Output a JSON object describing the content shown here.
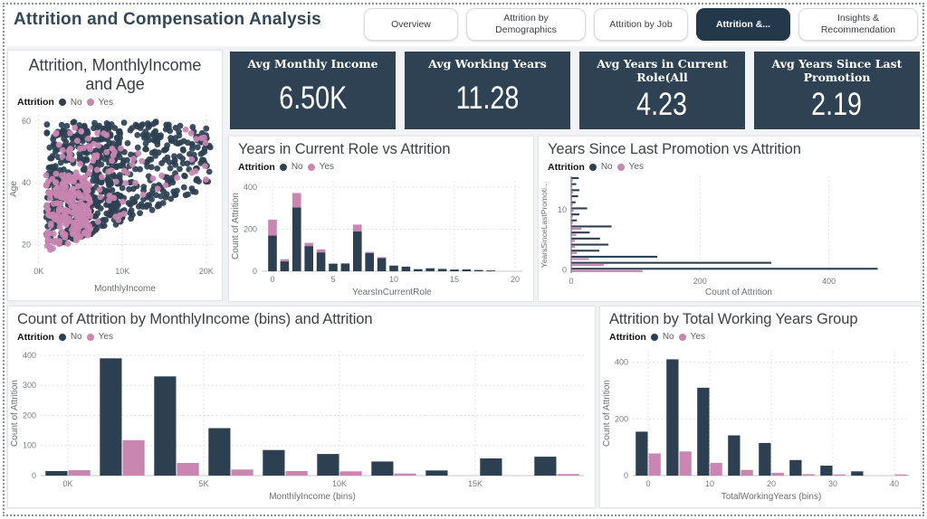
{
  "header": {
    "title": "Attrition and Compensation Analysis",
    "tabs": [
      {
        "label": "Overview",
        "active": false
      },
      {
        "label": "Attrition by Demographics",
        "active": false
      },
      {
        "label": "Attrition by Job",
        "active": false
      },
      {
        "label": "Attrition &...",
        "active": true
      },
      {
        "label": "Insights & Recommendation",
        "active": false
      }
    ]
  },
  "kpis": [
    {
      "title": "Avg Monthly Income",
      "value": "6.50K"
    },
    {
      "title": "Avg Working Years",
      "value": "11.28"
    },
    {
      "title": "Avg Years in Current Role(All",
      "value": "4.23"
    },
    {
      "title": "Avg Years Since Last Promotion",
      "value": "2.19"
    }
  ],
  "legend": {
    "title": "Attrition",
    "no": "No",
    "yes": "Yes"
  },
  "colors": {
    "no": "#2d4052",
    "yes": "#c886b1",
    "kpi_bg": "#2e4254",
    "active_tab_bg": "#24384b",
    "title_text": "#33475a",
    "grid": "#d8dadd",
    "tick_text": "#777b7f",
    "axis_line": "#9ea2a6"
  },
  "chart_data": [
    {
      "type": "scatter",
      "title": "Attrition, MonthlyIncome and Age",
      "xlabel": "MonthlyIncome",
      "ylabel": "Age",
      "xlim": [
        -400,
        21000
      ],
      "ylim": [
        14,
        62
      ],
      "xticks": [
        {
          "v": 0,
          "label": "0K"
        },
        {
          "v": 10000,
          "label": "10K"
        },
        {
          "v": 20000,
          "label": "20K"
        }
      ],
      "yticks": [
        {
          "v": 20,
          "label": "20"
        },
        {
          "v": 40,
          "label": "40"
        },
        {
          "v": 60,
          "label": "60"
        }
      ],
      "series": [
        {
          "name": "No"
        },
        {
          "name": "Yes"
        }
      ],
      "points_spec": {
        "min_age_base": 16.5,
        "min_age_slope_per_k": 1.08,
        "radius": 3.4,
        "no_clusters": [
          {
            "seed": 101,
            "n": 420,
            "x": [
              900,
              20500
            ],
            "y": [
              18,
              60
            ]
          },
          {
            "seed": 102,
            "n": 300,
            "x": [
              900,
              10000
            ],
            "y": [
              20,
              58
            ]
          }
        ],
        "yes_clusters": [
          {
            "seed": 201,
            "n": 200,
            "x": [
              900,
              6200
            ],
            "y": [
              17,
              43
            ]
          },
          {
            "seed": 202,
            "n": 60,
            "x": [
              2500,
              12500
            ],
            "y": [
              26,
              52
            ]
          },
          {
            "seed": 203,
            "n": 16,
            "x": [
              12500,
              20000
            ],
            "y": [
              38,
              58
            ]
          },
          {
            "seed": 204,
            "n": 22,
            "x": [
              1500,
              9000
            ],
            "y": [
              46,
              59
            ]
          }
        ]
      }
    },
    {
      "type": "stacked-bar",
      "title": "Years in Current Role vs Attrition",
      "xlabel": "YearsInCurrentRole",
      "ylabel": "Count of Attrition",
      "categories": [
        0,
        1,
        2,
        3,
        4,
        5,
        6,
        7,
        8,
        9,
        10,
        11,
        12,
        13,
        14,
        15,
        16,
        17,
        18
      ],
      "series": [
        {
          "name": "No",
          "values": [
            170,
            47,
            304,
            120,
            90,
            36,
            37,
            190,
            87,
            63,
            27,
            22,
            10,
            14,
            11,
            8,
            9,
            6,
            4
          ]
        },
        {
          "name": "Yes",
          "values": [
            75,
            10,
            68,
            15,
            14,
            0,
            0,
            32,
            5,
            4,
            0,
            0,
            0,
            0,
            0,
            0,
            0,
            0,
            0
          ]
        }
      ],
      "xlim": [
        -0.9,
        20.6
      ],
      "ylim": [
        0,
        430
      ],
      "xticks": [
        {
          "v": 0,
          "label": "0"
        },
        {
          "v": 5,
          "label": "5"
        },
        {
          "v": 10,
          "label": "10"
        },
        {
          "v": 15,
          "label": "15"
        },
        {
          "v": 20,
          "label": "20"
        }
      ],
      "yticks": [
        {
          "v": 0,
          "label": "0"
        },
        {
          "v": 200,
          "label": "200"
        },
        {
          "v": 400,
          "label": "400"
        }
      ]
    },
    {
      "type": "h-bar",
      "title": "Years Since Last Promotion vs Attrition",
      "xlabel": "Count of Attrition",
      "ylabel": "YearsSinceLastPromoti...",
      "categories": [
        0,
        1,
        2,
        3,
        4,
        5,
        6,
        7,
        8,
        9,
        10,
        11,
        12,
        13,
        14,
        15
      ],
      "series": [
        {
          "name": "No",
          "values": [
            475,
            310,
            133,
            43,
            57,
            44,
            28,
            62,
            8,
            12,
            24,
            6,
            10,
            12,
            7,
            11
          ]
        },
        {
          "name": "Yes",
          "values": [
            110,
            50,
            27,
            8,
            5,
            5,
            7,
            15,
            2,
            2,
            3,
            2,
            1,
            2,
            1,
            2
          ]
        }
      ],
      "xlim": [
        0,
        520
      ],
      "xticks": [
        {
          "v": 0,
          "label": "0"
        },
        {
          "v": 200,
          "label": "200"
        },
        {
          "v": 400,
          "label": "400"
        }
      ],
      "yticks": [
        {
          "v": 0,
          "label": "0"
        },
        {
          "v": 10,
          "label": "10"
        }
      ]
    },
    {
      "type": "grouped-bar",
      "title": "Count of Attrition by MonthlyIncome (bins) and Attrition",
      "xlabel": "MonthlyIncome (bins)",
      "ylabel": "Count of Attrition",
      "categories": [
        0,
        2000,
        4000,
        6000,
        8000,
        10000,
        12000,
        14000,
        16000,
        18000
      ],
      "series": [
        {
          "name": "No",
          "values": [
            15,
            390,
            330,
            158,
            85,
            72,
            47,
            17,
            57,
            63
          ]
        },
        {
          "name": "Yes",
          "values": [
            18,
            118,
            42,
            20,
            15,
            14,
            7,
            0,
            0,
            5
          ]
        }
      ],
      "xlim": [
        -1000,
        19000
      ],
      "ylim": [
        0,
        415
      ],
      "xticks": [
        {
          "v": 0,
          "label": "0K"
        },
        {
          "v": 5000,
          "label": "5K"
        },
        {
          "v": 10000,
          "label": "10K"
        },
        {
          "v": 15000,
          "label": "15K"
        }
      ],
      "yticks": [
        {
          "v": 0,
          "label": "0"
        },
        {
          "v": 100,
          "label": "100"
        },
        {
          "v": 200,
          "label": "200"
        },
        {
          "v": 300,
          "label": "300"
        },
        {
          "v": 400,
          "label": "400"
        }
      ]
    },
    {
      "type": "grouped-bar",
      "title": "Attrition by Total Working Years Group",
      "xlabel": "TotalWorkingYears (bins)",
      "ylabel": "Count of Attrition",
      "categories": [
        0,
        5,
        10,
        15,
        20,
        25,
        30,
        35,
        40
      ],
      "series": [
        {
          "name": "No",
          "values": [
            155,
            410,
            310,
            142,
            115,
            55,
            35,
            15,
            0
          ]
        },
        {
          "name": "Yes",
          "values": [
            78,
            85,
            45,
            20,
            10,
            5,
            4,
            0,
            4
          ]
        }
      ],
      "xlim": [
        -2.5,
        42.5
      ],
      "ylim": [
        0,
        440
      ],
      "xticks": [
        {
          "v": 0,
          "label": "0"
        },
        {
          "v": 10,
          "label": "10"
        },
        {
          "v": 20,
          "label": "20"
        },
        {
          "v": 30,
          "label": "30"
        },
        {
          "v": 40,
          "label": "40"
        }
      ],
      "yticks": [
        {
          "v": 0,
          "label": "0"
        },
        {
          "v": 200,
          "label": "200"
        },
        {
          "v": 400,
          "label": "400"
        }
      ]
    }
  ]
}
